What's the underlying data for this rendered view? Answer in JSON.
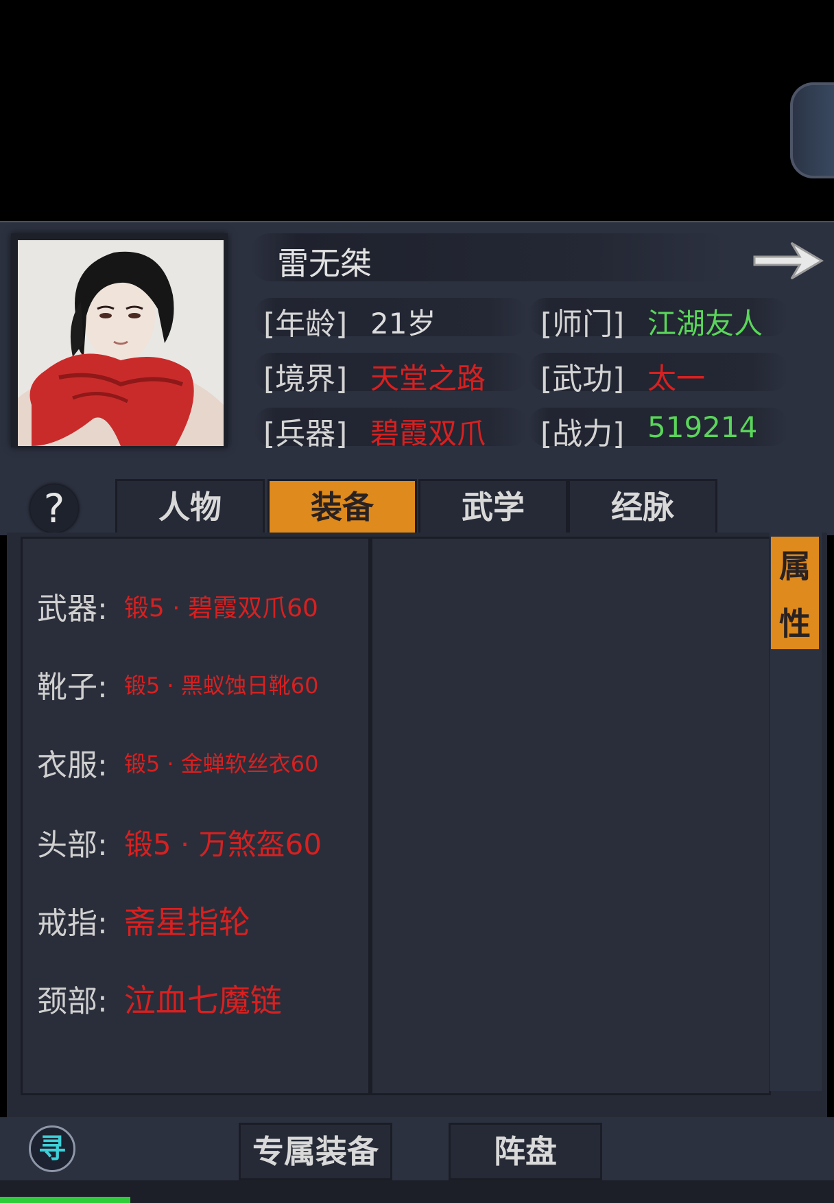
{
  "character": {
    "name": "雷无桀",
    "stats": [
      {
        "label": "[年龄]",
        "value": "21岁",
        "color": "white"
      },
      {
        "label": "[师门]",
        "value": "江湖友人",
        "color": "green"
      },
      {
        "label": "[境界]",
        "value": "天堂之路",
        "color": "red"
      },
      {
        "label": "[武功]",
        "value": "太一",
        "color": "red"
      },
      {
        "label": "[兵器]",
        "value": "碧霞双爪",
        "color": "red"
      },
      {
        "label": "[战力]",
        "value": "519214",
        "color": "green"
      }
    ]
  },
  "help": {
    "label": "?"
  },
  "tabs": [
    {
      "label": "人物",
      "active": false
    },
    {
      "label": "装备",
      "active": true
    },
    {
      "label": "武学",
      "active": false
    },
    {
      "label": "经脉",
      "active": false
    }
  ],
  "equipment": [
    {
      "label": "武器:",
      "value": "锻5 · 碧霞双爪60"
    },
    {
      "label": "靴子:",
      "value": "锻5 · 黑蚁蚀日靴60"
    },
    {
      "label": "衣服:",
      "value": "锻5 · 金蝉软丝衣60"
    },
    {
      "label": "头部:",
      "value": "锻5 · 万煞盔60"
    },
    {
      "label": "戒指:",
      "value": "斋星指轮"
    },
    {
      "label": "颈部:",
      "value": "泣血七魔链"
    }
  ],
  "side_button": {
    "chars": [
      "属",
      "性"
    ]
  },
  "bottom": {
    "search_glyph": "寻",
    "buttons": [
      "专属装备",
      "阵盘"
    ]
  },
  "colors": {
    "accent": "#df8a1c",
    "red": "#d82020",
    "green": "#5ad65a",
    "panel": "#2c3140"
  }
}
